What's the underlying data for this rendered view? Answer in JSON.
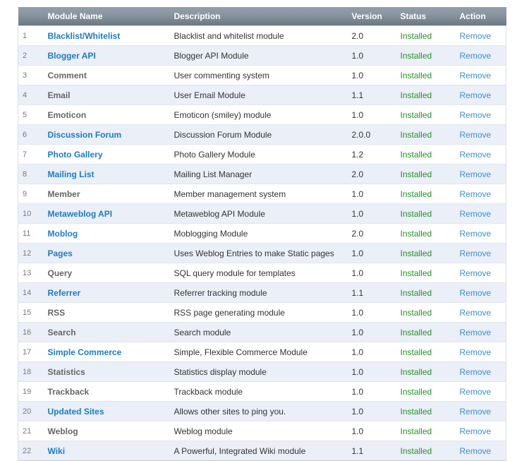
{
  "table": {
    "columns": [
      {
        "key": "num",
        "label": ""
      },
      {
        "key": "name",
        "label": "Module Name"
      },
      {
        "key": "desc",
        "label": "Description"
      },
      {
        "key": "version",
        "label": "Version"
      },
      {
        "key": "status",
        "label": "Status"
      },
      {
        "key": "action",
        "label": "Action"
      }
    ],
    "rows": [
      {
        "num": "1",
        "name": "Blacklist/Whitelist",
        "link": true,
        "desc": "Blacklist and whitelist module",
        "version": "2.0",
        "status": "Installed",
        "action": "Remove"
      },
      {
        "num": "2",
        "name": "Blogger API",
        "link": true,
        "desc": "Blogger API Module",
        "version": "1.0",
        "status": "Installed",
        "action": "Remove"
      },
      {
        "num": "3",
        "name": "Comment",
        "link": false,
        "desc": "User commenting system",
        "version": "1.0",
        "status": "Installed",
        "action": "Remove"
      },
      {
        "num": "4",
        "name": "Email",
        "link": false,
        "desc": "User Email Module",
        "version": "1.1",
        "status": "Installed",
        "action": "Remove"
      },
      {
        "num": "5",
        "name": "Emoticon",
        "link": false,
        "desc": "Emoticon (smiley) module",
        "version": "1.0",
        "status": "Installed",
        "action": "Remove"
      },
      {
        "num": "6",
        "name": "Discussion Forum",
        "link": true,
        "desc": "Discussion Forum Module",
        "version": "2.0.0",
        "status": "Installed",
        "action": "Remove"
      },
      {
        "num": "7",
        "name": "Photo Gallery",
        "link": true,
        "desc": "Photo Gallery Module",
        "version": "1.2",
        "status": "Installed",
        "action": "Remove"
      },
      {
        "num": "8",
        "name": "Mailing List",
        "link": true,
        "desc": "Mailing List Manager",
        "version": "2.0",
        "status": "Installed",
        "action": "Remove"
      },
      {
        "num": "9",
        "name": "Member",
        "link": false,
        "desc": "Member management system",
        "version": "1.0",
        "status": "Installed",
        "action": "Remove"
      },
      {
        "num": "10",
        "name": "Metaweblog API",
        "link": true,
        "desc": "Metaweblog API Module",
        "version": "1.0",
        "status": "Installed",
        "action": "Remove"
      },
      {
        "num": "11",
        "name": "Moblog",
        "link": true,
        "desc": "Moblogging Module",
        "version": "2.0",
        "status": "Installed",
        "action": "Remove"
      },
      {
        "num": "12",
        "name": "Pages",
        "link": true,
        "desc": "Uses Weblog Entries to make Static pages",
        "version": "1.0",
        "status": "Installed",
        "action": "Remove"
      },
      {
        "num": "13",
        "name": "Query",
        "link": false,
        "desc": "SQL query module for templates",
        "version": "1.0",
        "status": "Installed",
        "action": "Remove"
      },
      {
        "num": "14",
        "name": "Referrer",
        "link": true,
        "desc": "Referrer tracking module",
        "version": "1.1",
        "status": "Installed",
        "action": "Remove"
      },
      {
        "num": "15",
        "name": "RSS",
        "link": false,
        "desc": "RSS page generating module",
        "version": "1.0",
        "status": "Installed",
        "action": "Remove"
      },
      {
        "num": "16",
        "name": "Search",
        "link": false,
        "desc": "Search module",
        "version": "1.0",
        "status": "Installed",
        "action": "Remove"
      },
      {
        "num": "17",
        "name": "Simple Commerce",
        "link": true,
        "desc": "Simple, Flexible Commerce Module",
        "version": "1.0",
        "status": "Installed",
        "action": "Remove"
      },
      {
        "num": "18",
        "name": "Statistics",
        "link": false,
        "desc": "Statistics display module",
        "version": "1.0",
        "status": "Installed",
        "action": "Remove"
      },
      {
        "num": "19",
        "name": "Trackback",
        "link": false,
        "desc": "Trackback module",
        "version": "1.0",
        "status": "Installed",
        "action": "Remove"
      },
      {
        "num": "20",
        "name": "Updated Sites",
        "link": true,
        "desc": "Allows other sites to ping you.",
        "version": "1.0",
        "status": "Installed",
        "action": "Remove"
      },
      {
        "num": "21",
        "name": "Weblog",
        "link": false,
        "desc": "Weblog module",
        "version": "1.0",
        "status": "Installed",
        "action": "Remove"
      },
      {
        "num": "22",
        "name": "Wiki",
        "link": true,
        "desc": "A Powerful, Integrated Wiki module",
        "version": "1.1",
        "status": "Installed",
        "action": "Remove"
      }
    ]
  },
  "colors": {
    "header_gradient_top": "#929ea9",
    "header_gradient_bottom": "#6a7883",
    "header_text": "#ffffff",
    "row_odd": "#ffffff",
    "row_even": "#eaeff8",
    "link_blue": "#1d7cc4",
    "action_blue": "#3b8fd0",
    "status_green": "#279127",
    "plain_name": "#666666",
    "row_number": "#7a7a7a",
    "body_text": "#333333",
    "row_border": "#e2e6ec"
  }
}
